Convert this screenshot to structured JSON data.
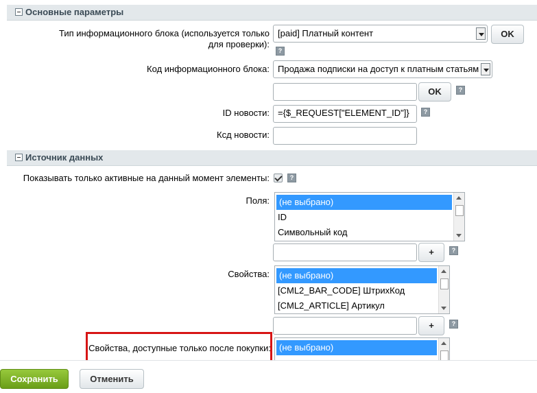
{
  "sections": {
    "main": "Основные параметры",
    "source": "Источник данных"
  },
  "fields": {
    "iblock_type_label": "Тип информационного блока (используется только для проверки):",
    "iblock_type_value": "[paid] Платный контент",
    "iblock_code_label": "Код информационного блока:",
    "iblock_code_value": "Продажа подписки на доступ к платным статьям",
    "news_id_label": "ID новости:",
    "news_id_value": "={$_REQUEST[\"ELEMENT_ID\"]}",
    "news_code_label": "Ксд новости:",
    "news_code_value": "",
    "active_only_label": "Показывать только активные на данный момент элементы:",
    "fields_label": "Поля:",
    "fields_options": [
      "(не выбрано)",
      "ID",
      "Символьный код"
    ],
    "props_label": "Свойства:",
    "props_options": [
      "(не выбрано)",
      "[CML2_BAR_CODE] ШтрихКод",
      "[CML2_ARTICLE] Артикул"
    ],
    "paid_props_label": "Свойства, доступные только после покупки:",
    "paid_props_options": [
      "(не выбрано)"
    ]
  },
  "buttons": {
    "ok": "OK",
    "plus": "+",
    "help": "?",
    "save": "Сохранить",
    "cancel": "Отменить"
  },
  "colors": {
    "highlight": "#d71515",
    "save_green": "#7aaf24",
    "list_selection": "#3399ff"
  }
}
